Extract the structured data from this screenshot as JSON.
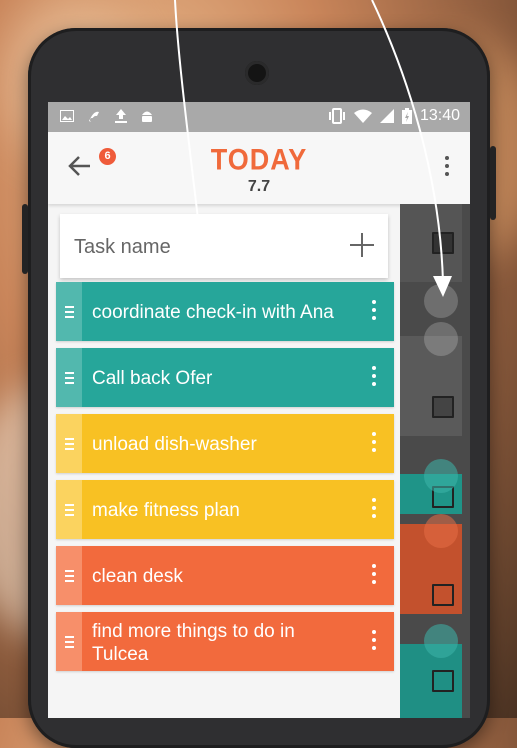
{
  "colors": {
    "teal": "#26a69a",
    "teal_handle": "#52b8ae",
    "yellow": "#f8c123",
    "yellow_handle": "#fbd35f",
    "orange": "#f26a3d",
    "orange_handle": "#f78f6a",
    "title": "#f06a3b",
    "badge": "#ef5b3a"
  },
  "statusbar": {
    "time": "13:40",
    "left_icons": [
      "image-icon",
      "audio-icon",
      "upload-icon",
      "android-icon"
    ],
    "right_icons": [
      "vibrate-icon",
      "wifi-icon",
      "signal-icon",
      "battery-icon"
    ]
  },
  "appbar": {
    "title": "TODAY",
    "date": "7.7",
    "badge_count": "6"
  },
  "task_input": {
    "placeholder": "Task name"
  },
  "tasks": [
    {
      "label": "coordinate check-in with Ana",
      "color": "teal"
    },
    {
      "label": "Call back Ofer",
      "color": "teal"
    },
    {
      "label": "unload dish-washer",
      "color": "yellow"
    },
    {
      "label": "make fitness plan",
      "color": "yellow"
    },
    {
      "label": "clean desk",
      "color": "orange"
    },
    {
      "label": "find more things to do in Tulcea",
      "color": "orange"
    }
  ]
}
